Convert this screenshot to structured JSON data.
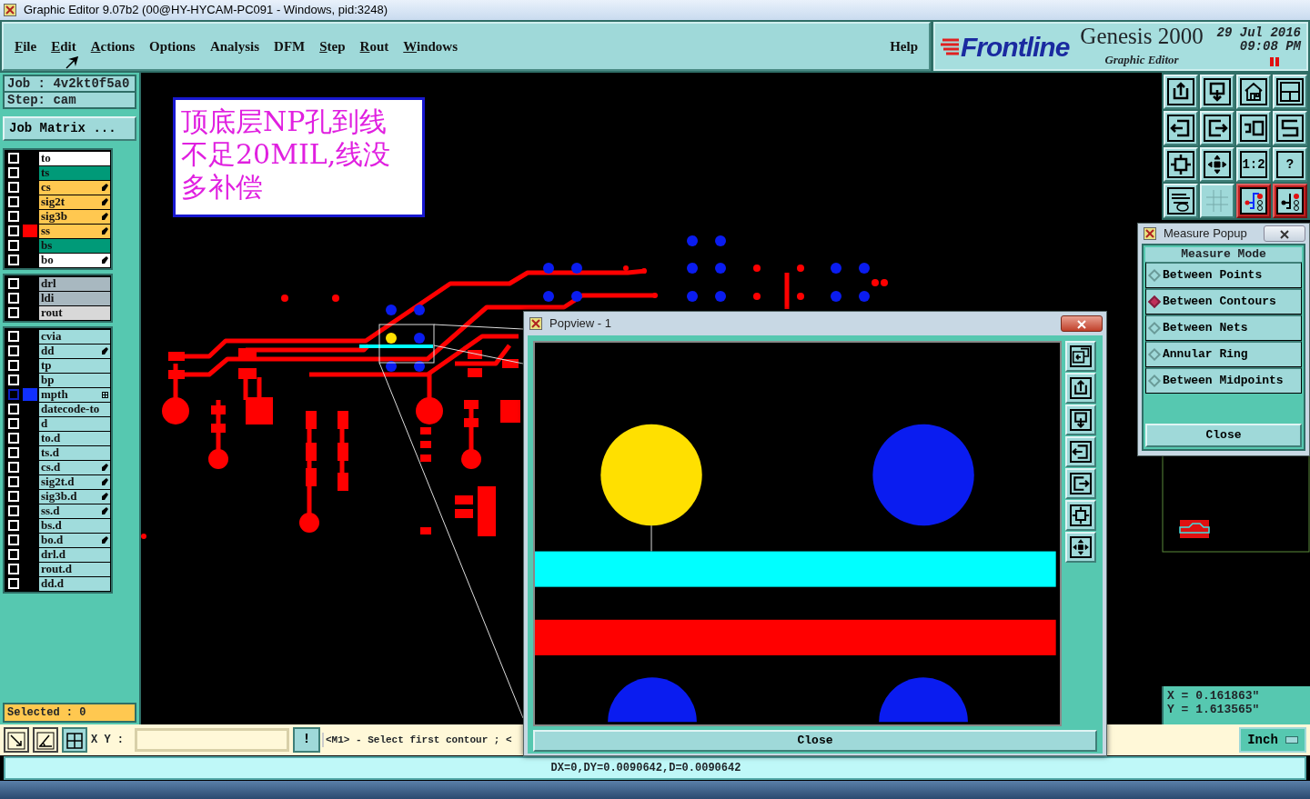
{
  "window": {
    "title": "Graphic Editor 9.07b2 (00@HY-HYCAM-PC091 - Windows, pid:3248)"
  },
  "menu": [
    {
      "label": "File",
      "mnemonic": true
    },
    {
      "label": "Edit",
      "mnemonic": true
    },
    {
      "label": "Actions",
      "mnemonic": true
    },
    {
      "label": "Options",
      "mnemonic": false
    },
    {
      "label": "Analysis",
      "mnemonic": false
    },
    {
      "label": "DFM",
      "mnemonic": false
    },
    {
      "label": "Step",
      "mnemonic": true
    },
    {
      "label": "Rout",
      "mnemonic": true
    },
    {
      "label": "Windows",
      "mnemonic": true
    }
  ],
  "help": "Help",
  "brand": {
    "logo": "Frontline",
    "product": "Genesis 2000",
    "subtitle": "Graphic Editor",
    "date": "29 Jul 2016",
    "time": "09:08 PM"
  },
  "job": {
    "job": "Job  :  4v2kt0f5a0",
    "step": "Step:  cam",
    "matrix_button": "Job Matrix ...",
    "selected": "Selected : 0"
  },
  "layer_groups": [
    [
      {
        "name": "to",
        "color": "#ffffff",
        "checked": false,
        "work": false,
        "displayed": false,
        "modified": false,
        "merged": false
      },
      {
        "name": "ts",
        "color": "#009a78",
        "checked": false,
        "work": false,
        "displayed": false,
        "modified": false,
        "merged": false
      },
      {
        "name": "cs",
        "color": "#ffc850",
        "checked": false,
        "work": false,
        "displayed": false,
        "modified": true,
        "merged": false
      },
      {
        "name": "sig2t",
        "color": "#ffc850",
        "checked": false,
        "work": false,
        "displayed": false,
        "modified": true,
        "merged": false
      },
      {
        "name": "sig3b",
        "color": "#ffc850",
        "checked": false,
        "work": false,
        "displayed": false,
        "modified": true,
        "merged": false
      },
      {
        "name": "ss",
        "color": "#ffc850",
        "checked": false,
        "work": true,
        "displayed": false,
        "modified": true,
        "merged": false
      },
      {
        "name": "bs",
        "color": "#009a78",
        "checked": false,
        "work": false,
        "displayed": false,
        "modified": false,
        "merged": false
      },
      {
        "name": "bo",
        "color": "#ffffff",
        "checked": false,
        "work": false,
        "displayed": false,
        "modified": true,
        "merged": false
      }
    ],
    [
      {
        "name": "drl",
        "color": "#a8b8c0",
        "checked": false,
        "work": false,
        "displayed": false,
        "modified": false,
        "merged": false
      },
      {
        "name": "ldi",
        "color": "#a8b8c0",
        "checked": false,
        "work": false,
        "displayed": false,
        "modified": false,
        "merged": false
      },
      {
        "name": "rout",
        "color": "#d8d8d8",
        "checked": false,
        "work": false,
        "displayed": false,
        "modified": false,
        "merged": false
      }
    ],
    [
      {
        "name": "cvia",
        "color": "#a0dcdc",
        "checked": false,
        "work": false,
        "displayed": false,
        "modified": false,
        "merged": false
      },
      {
        "name": "dd",
        "color": "#a0dcdc",
        "checked": false,
        "work": false,
        "displayed": false,
        "modified": true,
        "merged": false
      },
      {
        "name": "tp",
        "color": "#a0dcdc",
        "checked": false,
        "work": false,
        "displayed": false,
        "modified": false,
        "merged": false
      },
      {
        "name": "bp",
        "color": "#a0dcdc",
        "checked": false,
        "work": false,
        "displayed": false,
        "modified": false,
        "merged": false
      },
      {
        "name": "mpth",
        "color": "#a0dcdc",
        "checked": false,
        "work": false,
        "displayed": true,
        "modified": false,
        "merged": true
      },
      {
        "name": "datecode-to",
        "color": "#a0dcdc",
        "checked": false,
        "work": false,
        "displayed": false,
        "modified": false,
        "merged": false
      },
      {
        "name": "d",
        "color": "#a0dcdc",
        "checked": false,
        "work": false,
        "displayed": false,
        "modified": false,
        "merged": false
      },
      {
        "name": "to.d",
        "color": "#a0dcdc",
        "checked": false,
        "work": false,
        "displayed": false,
        "modified": false,
        "merged": false
      },
      {
        "name": "ts.d",
        "color": "#a0dcdc",
        "checked": false,
        "work": false,
        "displayed": false,
        "modified": false,
        "merged": false
      },
      {
        "name": "cs.d",
        "color": "#a0dcdc",
        "checked": false,
        "work": false,
        "displayed": false,
        "modified": true,
        "merged": false
      },
      {
        "name": "sig2t.d",
        "color": "#a0dcdc",
        "checked": false,
        "work": false,
        "displayed": false,
        "modified": true,
        "merged": false
      },
      {
        "name": "sig3b.d",
        "color": "#a0dcdc",
        "checked": false,
        "work": false,
        "displayed": false,
        "modified": true,
        "merged": false
      },
      {
        "name": "ss.d",
        "color": "#a0dcdc",
        "checked": false,
        "work": false,
        "displayed": false,
        "modified": true,
        "merged": false
      },
      {
        "name": "bs.d",
        "color": "#a0dcdc",
        "checked": false,
        "work": false,
        "displayed": false,
        "modified": false,
        "merged": false
      },
      {
        "name": "bo.d",
        "color": "#a0dcdc",
        "checked": false,
        "work": false,
        "displayed": false,
        "modified": true,
        "merged": false
      },
      {
        "name": "drl.d",
        "color": "#a0dcdc",
        "checked": false,
        "work": false,
        "displayed": false,
        "modified": false,
        "merged": false
      },
      {
        "name": "rout.d",
        "color": "#a0dcdc",
        "checked": false,
        "work": false,
        "displayed": false,
        "modified": false,
        "merged": false
      },
      {
        "name": "dd.d",
        "color": "#a0dcdc",
        "checked": false,
        "work": false,
        "displayed": false,
        "modified": false,
        "merged": false
      }
    ]
  ],
  "note": {
    "lines": [
      "顶底层NP孔到线",
      "不足20MIL,线没",
      "多补偿"
    ]
  },
  "toolbar": [
    {
      "kind": "up",
      "active": false
    },
    {
      "kind": "down",
      "active": false
    },
    {
      "kind": "home",
      "active": false
    },
    {
      "kind": "xy",
      "active": false
    },
    {
      "kind": "left",
      "active": false
    },
    {
      "kind": "right",
      "active": false
    },
    {
      "kind": "undo",
      "active": false
    },
    {
      "kind": "snake",
      "active": false
    },
    {
      "kind": "fit",
      "active": false
    },
    {
      "kind": "pan",
      "active": false
    },
    {
      "kind": "ratio",
      "label": "1:2",
      "active": false
    },
    {
      "kind": "help",
      "label": "?",
      "active": false
    },
    {
      "kind": "tools",
      "active": false
    },
    {
      "kind": "grid",
      "active": false
    },
    {
      "kind": "net",
      "active": true
    },
    {
      "kind": "net2",
      "active": true
    }
  ],
  "measure": {
    "title": "Measure Popup",
    "heading": "Measure Mode",
    "options": [
      {
        "label": "Between Points",
        "selected": false
      },
      {
        "label": "Between Contours",
        "selected": true
      },
      {
        "label": "Between Nets",
        "selected": false
      },
      {
        "label": "Annular Ring",
        "selected": false
      },
      {
        "label": "Between Midpoints",
        "selected": false
      }
    ],
    "close": "Close"
  },
  "coords": {
    "x": "X = 0.161863\"",
    "y": "Y = 1.613565\""
  },
  "popview": {
    "title": "Popview - 1",
    "tools": [
      {
        "kind": "zoom"
      },
      {
        "kind": "up"
      },
      {
        "kind": "down"
      },
      {
        "kind": "left"
      },
      {
        "kind": "right"
      },
      {
        "kind": "fit"
      },
      {
        "kind": "pan"
      }
    ],
    "close": "Close"
  },
  "bottom": {
    "xy_label": "X Y :",
    "bang": "!",
    "prompt": "<M1> - Select first contour ; <",
    "units": "Inch"
  },
  "status_bar": "DX=0,DY=0.0090642,D=0.0090642"
}
